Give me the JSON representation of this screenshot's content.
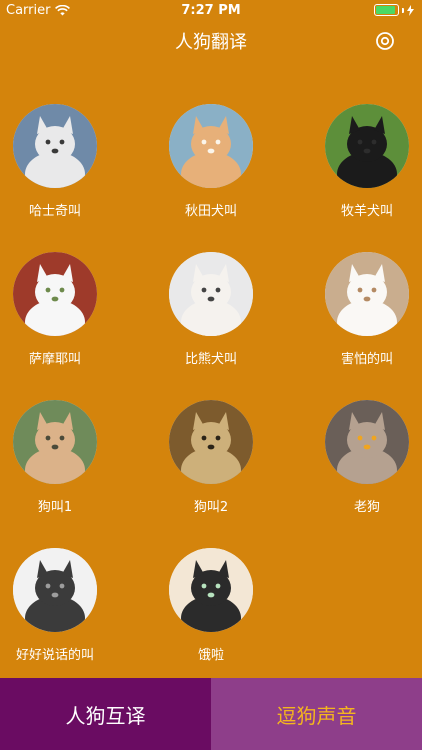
{
  "status": {
    "carrier": "Carrier",
    "time": "7:27 PM"
  },
  "header": {
    "title": "人狗翻译",
    "settings_icon": "settings-ring-icon"
  },
  "dogs": [
    {
      "label": "哈士奇叫",
      "icon": "husky-photo",
      "palette": [
        "#6f8aa8",
        "#e9e9ea",
        "#3a3a3a"
      ]
    },
    {
      "label": "秋田犬叫",
      "icon": "akita-photo",
      "palette": [
        "#8ab0c6",
        "#e7b079",
        "#fbf5ea"
      ]
    },
    {
      "label": "牧羊犬叫",
      "icon": "shepherd-photo",
      "palette": [
        "#5d8f3a",
        "#1b1b1b",
        "#2d2d2d"
      ]
    },
    {
      "label": "萨摩耶叫",
      "icon": "samoyed-photo",
      "palette": [
        "#9e3a2a",
        "#f7f7f7",
        "#6e8a4c"
      ]
    },
    {
      "label": "比熊犬叫",
      "icon": "bichon-photo",
      "palette": [
        "#e9e9ea",
        "#f5f2ee",
        "#444444"
      ]
    },
    {
      "label": "害怕的叫",
      "icon": "pomeranian-photo",
      "palette": [
        "#c9ad8e",
        "#faf8f5",
        "#b48a63"
      ]
    },
    {
      "label": "狗叫1",
      "icon": "poodle-photo",
      "palette": [
        "#6f8b5a",
        "#dbb289",
        "#4b4b3a"
      ]
    },
    {
      "label": "狗叫2",
      "icon": "pug-photo",
      "palette": [
        "#7d5b2d",
        "#cdb07a",
        "#2b2418"
      ]
    },
    {
      "label": "老狗",
      "icon": "bulldog-photo",
      "palette": [
        "#6a5f58",
        "#b5a190",
        "#f0a51f"
      ]
    },
    {
      "label": "好好说话的叫",
      "icon": "great-dane-photo",
      "palette": [
        "#f2f2f2",
        "#3b3b3b",
        "#9d9d9d"
      ]
    },
    {
      "label": "饿啦",
      "icon": "frenchie-photo",
      "palette": [
        "#f3e7d5",
        "#2b2b2b",
        "#b7e3bf"
      ]
    }
  ],
  "tabs": [
    {
      "label": "人狗互译",
      "active": true
    },
    {
      "label": "逗狗声音",
      "active": false
    }
  ],
  "colors": {
    "background": "#d4840c",
    "tab_active_bg": "#6a0c62",
    "tab_inactive_bg": "#8e3e8a",
    "tab_inactive_text": "#f4b51e",
    "battery": "#4cd964"
  }
}
